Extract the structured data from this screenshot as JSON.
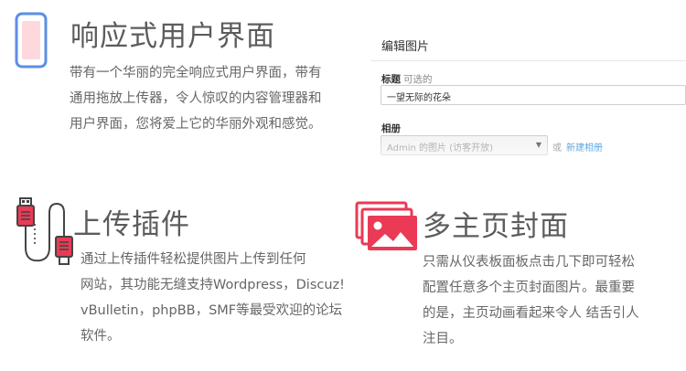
{
  "responsive": {
    "title": "响应式用户界面",
    "lines": [
      "带有一个华丽的完全响应式用户界面，带有",
      "通用拖放上传器，令人惊叹的内容管理器和",
      "用户界面，您将爱上它的华丽外观和感觉。"
    ],
    "icon": "phone-icon"
  },
  "editor": {
    "heading": "编辑图片",
    "title_label": "标题",
    "title_optional": "可选的",
    "title_value": "一望无际的花朵",
    "album_label": "相册",
    "album_value": "Admin 的图片 (访客开放)",
    "or_text": "或",
    "new_album_link": "新建相册"
  },
  "uploader": {
    "title": "上传插件",
    "lines": [
      "通过上传插件轻松提供图片上传到任何",
      "网站，其功能无缝支持Wordpress，Discuz!",
      "vBulletin，phpBB，SMF等最受欢迎的论坛",
      "软件。"
    ],
    "icon": "usb-cable-icon"
  },
  "homepage": {
    "title": "多主页封面",
    "lines": [
      "只需从仪表板面板点击几下即可轻松",
      "配置任意多个主页封面图片。最重要",
      "的是，主页动画看起来令人 结舌引人",
      "注目。"
    ],
    "icon": "stacked-images-icon"
  },
  "colors": {
    "accent_red": "#ea3a55",
    "phone_blue": "#5b8fe6",
    "phone_screen": "#fdd9dd",
    "link_blue": "#2a8ad8"
  }
}
